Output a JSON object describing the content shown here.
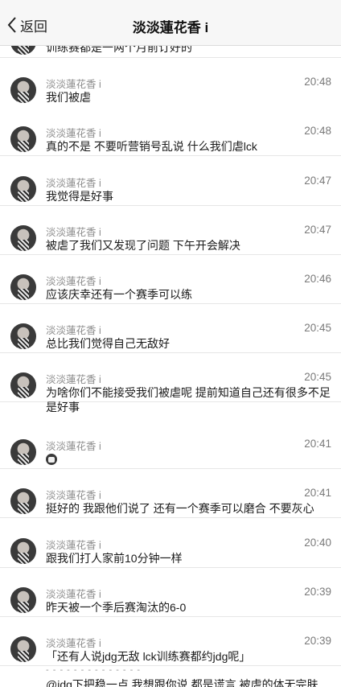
{
  "navbar": {
    "back_label": "返回",
    "title": "淡淡蓮花香 i"
  },
  "top_partial_text": "训练赛都是一两个月前订好的",
  "messages": [
    {
      "name": "淡淡蓮花香 i",
      "time": "20:48",
      "text": "我们被虐"
    },
    {
      "name": "淡淡蓮花香 i",
      "time": "20:48",
      "text": "真的不是 不要听营销号乱说 什么我们虐lck"
    },
    {
      "name": "淡淡蓮花香 i",
      "time": "20:47",
      "text": "我觉得是好事"
    },
    {
      "name": "淡淡蓮花香 i",
      "time": "20:47",
      "text": "被虐了我们又发现了问题 下午开会解决"
    },
    {
      "name": "淡淡蓮花香 i",
      "time": "20:46",
      "text": "应该庆幸还有一个赛季可以练"
    },
    {
      "name": "淡淡蓮花香 i",
      "time": "20:45",
      "text": "总比我们觉得自己无敌好"
    },
    {
      "name": "淡淡蓮花香 i",
      "time": "20:45",
      "text": "为啥你们不能接受我们被虐呢 提前知道自己还有很多不足是好事"
    },
    {
      "name": "淡淡蓮花香 i",
      "time": "20:41",
      "text": "",
      "emoji": "face-emoji"
    },
    {
      "name": "淡淡蓮花香 i",
      "time": "20:41",
      "text": "挺好的 我跟他们说了 还有一个赛季可以磨合 不要灰心"
    },
    {
      "name": "淡淡蓮花香 i",
      "time": "20:40",
      "text": "跟我们打人家前10分钟一样"
    },
    {
      "name": "淡淡蓮花香 i",
      "time": "20:39",
      "text": "昨天被一个季后赛淘汰的6-0"
    },
    {
      "name": "淡淡蓮花香 i",
      "time": "20:39",
      "text": "「还有人说jdg无敌 lck训练赛都约jdg呢」",
      "divider": "- - - - - - - - - - - - - -",
      "reply": "@jdg下把稳一点 我想跟你说 都是谎言 被虐的体无完肤"
    }
  ]
}
